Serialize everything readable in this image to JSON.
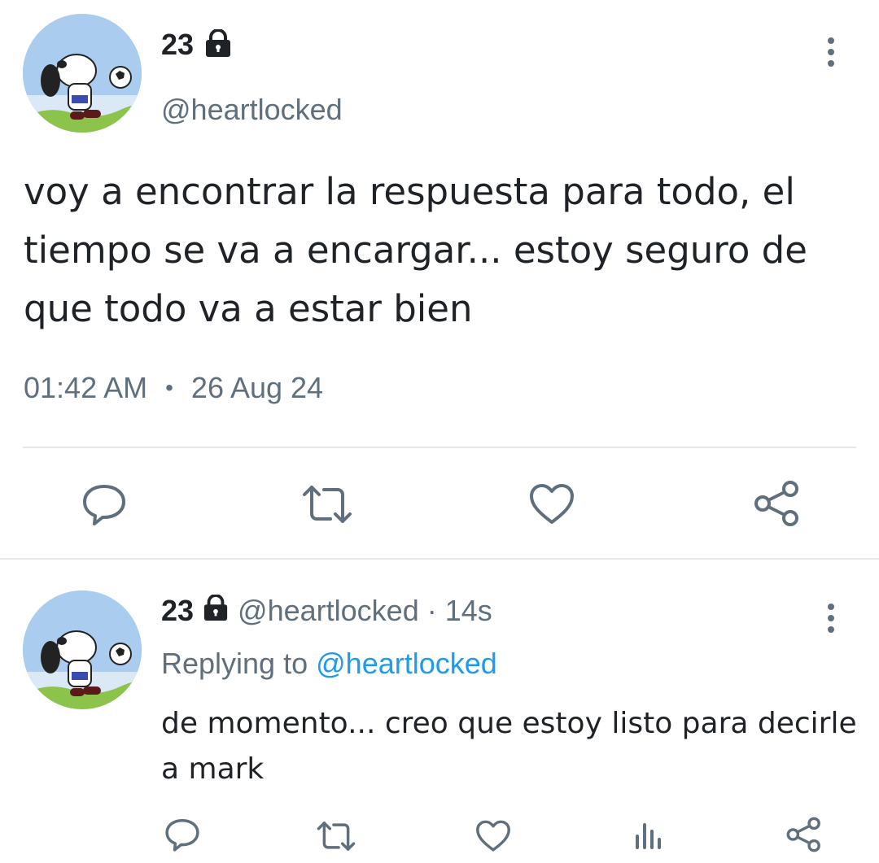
{
  "tweet": {
    "author_name": "23",
    "author_handle": "@heartlocked",
    "text": "voy a encontrar la respuesta para todo, el tiempo se va a encargar... estoy seguro de que todo va a estar bien",
    "time": "01:42 AM",
    "separator": "•",
    "date": "26 Aug 24"
  },
  "reply": {
    "author_name": "23",
    "author_handle": "@heartlocked",
    "age_separator": "·",
    "age": "14s",
    "replying_prefix": "Replying to",
    "replying_handle": "@heartlocked",
    "text": "de momento... creo que estoy listo para decirle a mark"
  },
  "icons": {
    "lock": "lock-icon",
    "more": "more-vertical-icon",
    "reply": "reply-bubble-icon",
    "retweet": "retweet-icon",
    "like": "heart-icon",
    "views": "bar-chart-icon",
    "share": "share-icon"
  },
  "colors": {
    "text": "#1f2328",
    "secondary": "#5f6f7d",
    "link": "#1d9bf0",
    "divider": "#e5e8eb",
    "avatar_sky": "#a9ccef"
  }
}
